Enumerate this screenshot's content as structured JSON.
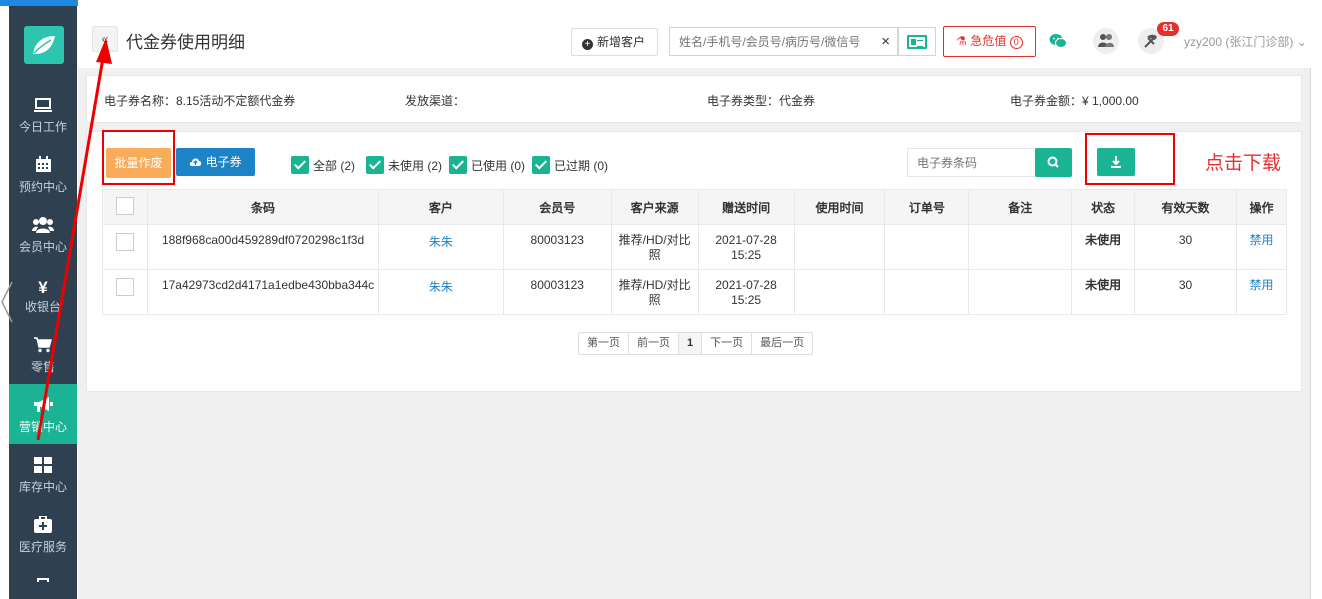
{
  "sidebar": {
    "items": [
      {
        "label": "今日工作",
        "icon": "monitor-icon"
      },
      {
        "label": "预约中心",
        "icon": "calendar-icon"
      },
      {
        "label": "会员中心",
        "icon": "users-icon"
      },
      {
        "label": "收银台",
        "icon": "yen-icon",
        "icon_glyph": "¥"
      },
      {
        "label": "零售",
        "icon": "cart-icon"
      },
      {
        "label": "营销中心",
        "icon": "megaphone-icon",
        "active": true
      },
      {
        "label": "库存中心",
        "icon": "grid-icon"
      },
      {
        "label": "医疗服务",
        "icon": "medkit-icon"
      }
    ]
  },
  "header": {
    "title": "代金券使用明细",
    "back_glyph": "«",
    "add_customer_label": "新增客户",
    "search_placeholder": "姓名/手机号/会员号/病历号/微信号",
    "clear_glyph": "×",
    "urgent_label": "急危值",
    "urgent_count": "0",
    "notification_count": "61",
    "user_label": "yzy200 (张江门诊部)"
  },
  "info": {
    "name": "电子券名称：8.15活动不定额代金券",
    "channel": "发放渠道：",
    "type": "电子券类型：代金券",
    "amount": "电子券金额：¥ 1,000.00"
  },
  "toolbar": {
    "batch_void_label": "批量作废",
    "ecoupon_label": "电子券",
    "filters": [
      {
        "label": "全部 (2)",
        "checked": true
      },
      {
        "label": "未使用 (2)",
        "checked": true
      },
      {
        "label": "已使用 (0)",
        "checked": true
      },
      {
        "label": "已过期 (0)",
        "checked": true
      }
    ],
    "code_search_placeholder": "电子券条码",
    "annotation": "点击下载"
  },
  "table": {
    "columns": [
      "条码",
      "客户",
      "会员号",
      "客户来源",
      "赠送时间",
      "使用时间",
      "订单号",
      "备注",
      "状态",
      "有效天数",
      "操作"
    ],
    "rows": [
      {
        "code": "188f968ca00d459289df0720298c1f3d",
        "customer": "朱朱",
        "member_no": "80003123",
        "source": "推荐/HD/对比照",
        "sent_date": "2021-07-28",
        "sent_time": "15:25",
        "used_time": "",
        "order_no": "",
        "remark": "",
        "status": "未使用",
        "valid_days": "30",
        "action": "禁用"
      },
      {
        "code": "17a42973cd2d4171a1edbe430bba344c",
        "customer": "朱朱",
        "member_no": "80003123",
        "source": "推荐/HD/对比照",
        "sent_date": "2021-07-28",
        "sent_time": "15:25",
        "used_time": "",
        "order_no": "",
        "remark": "",
        "status": "未使用",
        "valid_days": "30",
        "action": "禁用"
      }
    ]
  },
  "pagination": {
    "first": "第一页",
    "prev": "前一页",
    "current": "1",
    "next": "下一页",
    "last": "最后一页"
  },
  "colors": {
    "sidebar_bg": "#2f4050",
    "accent_green": "#1ab394",
    "accent_blue": "#1c84c6",
    "warning_orange": "#f8ac59",
    "annotation_red": "#e62e2e"
  }
}
